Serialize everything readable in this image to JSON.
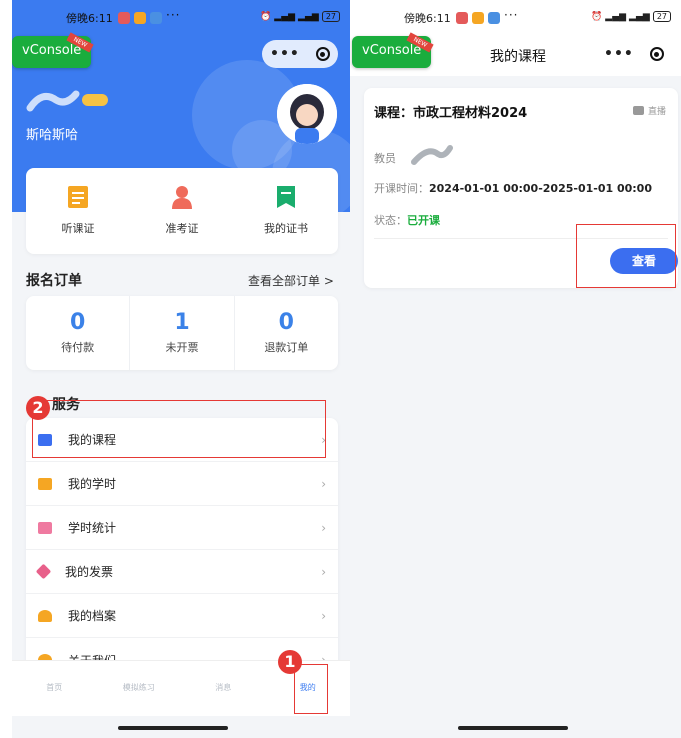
{
  "status_bar": {
    "time": "傍晚6:11",
    "dots": "···",
    "battery": "27"
  },
  "vconsole": {
    "label": "vConsole",
    "ribbon": "NEW"
  },
  "left": {
    "username": "斯哈斯哈",
    "quick_actions": [
      "听课证",
      "准考证",
      "我的证书"
    ],
    "orders_section": {
      "title": "报名订单",
      "link": "查看全部订单 >"
    },
    "orders": [
      {
        "count": "0",
        "label": "待付款"
      },
      {
        "count": "1",
        "label": "未开票"
      },
      {
        "count": "0",
        "label": "退款订单"
      }
    ],
    "services_title": "服务",
    "services": [
      "我的课程",
      "我的学时",
      "学时统计",
      "我的发票",
      "我的档案",
      "关于我们"
    ],
    "tabs": [
      "首页",
      "模拟练习",
      "消息",
      "我的"
    ],
    "active_tab": "我的",
    "step_badges": [
      "1",
      "2"
    ]
  },
  "right": {
    "nav_title": "我的课程",
    "course": {
      "title": "课程：市政工程材料2024",
      "live": "直播",
      "teacher_label": "教员",
      "time_label": "开课时间：",
      "time_value": "2024-01-01 00:00-2025-01-01 00:00",
      "status_label": "状态：",
      "status_value": "已开课",
      "button": "查看"
    }
  },
  "colors": {
    "primary": "#3b7bf0",
    "green": "#1aad3d",
    "annotation_red": "#e53935"
  }
}
